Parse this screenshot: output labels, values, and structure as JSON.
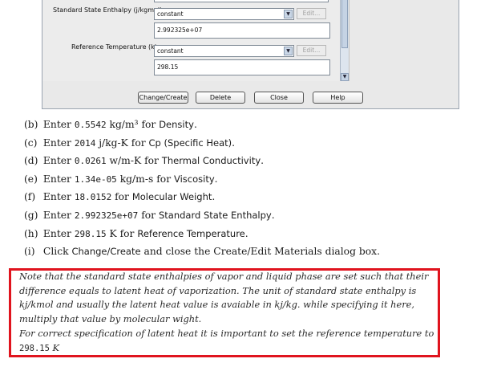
{
  "dialog": {
    "properties": [
      {
        "label": "Standard State Enthalpy (j/kgmol)",
        "method": "constant",
        "edit": "Edit...",
        "value": "2.992325e+07"
      },
      {
        "label": "Reference Temperature (k)",
        "method": "constant",
        "edit": "Edit...",
        "value": "298.15"
      }
    ],
    "buttons": {
      "change_create": "Change/Create",
      "delete": "Delete",
      "close": "Close",
      "help": "Help"
    }
  },
  "steps": [
    {
      "tag": "(b)",
      "pre": "Enter ",
      "value": "0.5542",
      "unit": " kg/m³",
      "post": " for ",
      "prop": "Density",
      "end": "."
    },
    {
      "tag": "(c)",
      "pre": "Enter ",
      "value": "2014",
      "unit": " j/kg-K",
      "post": " for ",
      "prop": "Cp (Specific Heat)",
      "end": "."
    },
    {
      "tag": "(d)",
      "pre": "Enter ",
      "value": "0.0261",
      "unit": " w/m-K",
      "post": " for ",
      "prop": "Thermal Conductivity",
      "end": "."
    },
    {
      "tag": "(e)",
      "pre": "Enter ",
      "value": "1.34e-05",
      "unit": " kg/m-s",
      "post": " for ",
      "prop": "Viscosity",
      "end": "."
    },
    {
      "tag": "(f)",
      "pre": "Enter ",
      "value": "18.0152",
      "unit": "",
      "post": " for ",
      "prop": "Molecular Weight",
      "end": "."
    },
    {
      "tag": "(g)",
      "pre": "Enter ",
      "value": "2.992325e+07",
      "unit": "",
      "post": " for ",
      "prop": "Standard State Enthalpy",
      "end": "."
    },
    {
      "tag": "(h)",
      "pre": "Enter ",
      "value": "298.15",
      "unit": " K",
      "post": " for ",
      "prop": "Reference Temperature",
      "end": "."
    },
    {
      "tag": "(i)",
      "pre": "Click ",
      "value": "",
      "unit": "",
      "post": "",
      "prop": "Change/Create",
      "end": " and close the Create/Edit Materials dialog box."
    }
  ],
  "note": {
    "paragraph1": "Note that the standard state enthalpies of vapor and liquid phase are set such that their difference equals to latent heat of vaporization.  The unit of standard state enthalpy is kj/kmol and usually the latent heat value is avaiable in kj/kg.  while specifying it here, multiply that value by molecular wight.",
    "paragraph2_text": "For correct specification of latent heat it is important to set the reference temperature to ",
    "paragraph2_value": "298.15",
    "paragraph2_unit": " K"
  },
  "colors": {
    "highlight_border": "#e0141e",
    "dialog_bg": "#e9e9e9"
  }
}
